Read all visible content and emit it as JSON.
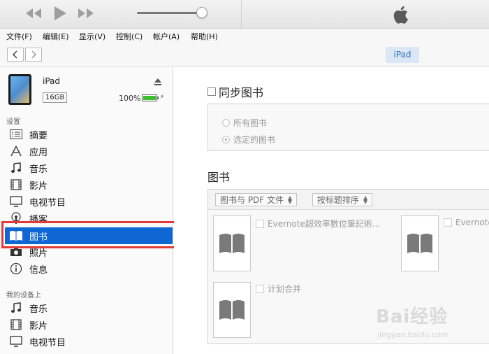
{
  "menu": [
    "文件(F)",
    "编辑(E)",
    "显示(V)",
    "控制(C)",
    "帐户(A)",
    "帮助(H)"
  ],
  "nav": {
    "device_label": "iPad"
  },
  "device": {
    "name": "iPad",
    "capacity": "16GB",
    "battery_text": "100%",
    "battery_level": 1.0
  },
  "sidebar": {
    "settings_label": "设置",
    "settings_items": [
      {
        "label": "摘要",
        "icon": "summary-icon"
      },
      {
        "label": "应用",
        "icon": "apps-icon"
      },
      {
        "label": "音乐",
        "icon": "music-icon"
      },
      {
        "label": "影片",
        "icon": "film-icon"
      },
      {
        "label": "电视节目",
        "icon": "tv-icon"
      },
      {
        "label": "播客",
        "icon": "podcast-icon"
      },
      {
        "label": "图书",
        "icon": "book-icon",
        "selected": true
      },
      {
        "label": "照片",
        "icon": "camera-icon"
      },
      {
        "label": "信息",
        "icon": "info-icon"
      }
    ],
    "mydevice_label": "我的设备上",
    "mydevice_items": [
      {
        "label": "音乐",
        "icon": "music-icon"
      },
      {
        "label": "影片",
        "icon": "film-icon"
      },
      {
        "label": "电视节目",
        "icon": "tv-icon"
      }
    ]
  },
  "main": {
    "sync_label": "同步图书",
    "option_all": "所有图书",
    "option_selected": "选定的图书",
    "books_title": "图书",
    "filter_label": "图书与 PDF 文件",
    "sort_label": "按标题排序",
    "books": [
      {
        "title": "Evernote超效率數位筆記術..."
      },
      {
        "title": "Evernote"
      },
      {
        "title": "计划合并"
      }
    ]
  },
  "watermark": {
    "main": "Bai经验",
    "sub": "jingyan.baidu.com"
  },
  "colors": {
    "selection": "#0f67d4",
    "highlight": "#e53935",
    "device_pill": "#dbe7f4"
  }
}
